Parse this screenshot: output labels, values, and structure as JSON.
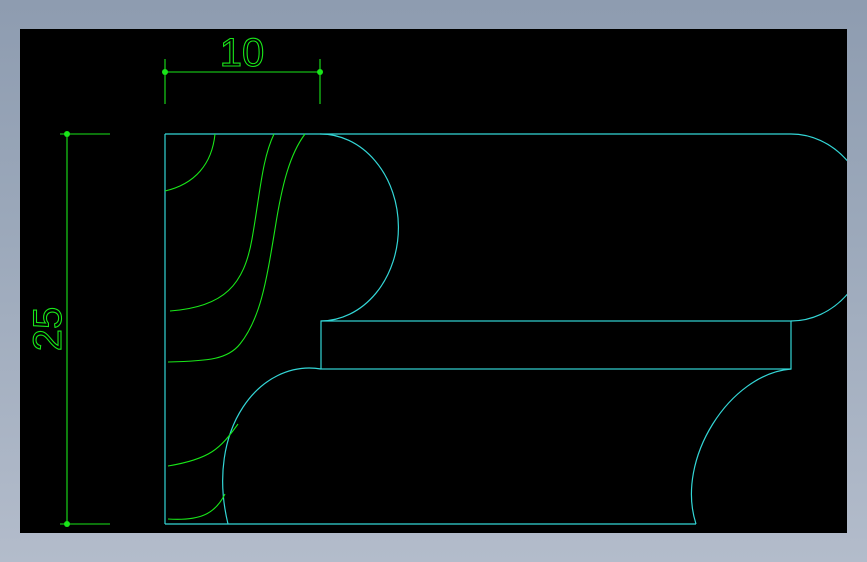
{
  "colors": {
    "background_gradient_top": "#8e9cb0",
    "viewport_background": "#000000",
    "profile_outline": "#33d6d6",
    "dimension_and_grain": "#19e619"
  },
  "drawing": {
    "horizontal_dimension": {
      "value": "10"
    },
    "vertical_dimension": {
      "value": "25"
    }
  }
}
